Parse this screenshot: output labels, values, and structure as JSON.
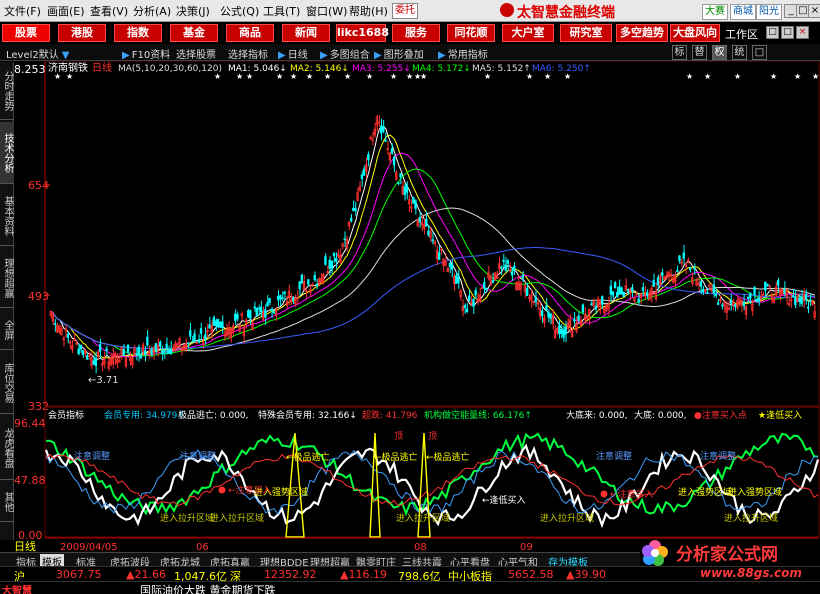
{
  "menubar": {
    "items": [
      "文件(F)",
      "画面(E)",
      "查看(V)",
      "分析(A)",
      "决策(J)",
      "公式(Q)",
      "工具(T)",
      "窗口(W)",
      "帮助(H)"
    ],
    "special_button": "委托",
    "brand": "太智慧金融终端",
    "skins": [
      "大赛",
      "商城",
      "阳光"
    ],
    "window_controls": [
      "_",
      "□",
      "×"
    ]
  },
  "toolbar": {
    "buttons": [
      "股票",
      "港股",
      "指数",
      "基金",
      "商品",
      "新闻",
      "likc1688",
      "服务",
      "同花顺",
      "大户室",
      "研究室",
      "多空趋势",
      "大盘风向"
    ],
    "workarea": "工作区",
    "controls": [
      "□",
      "□",
      "×"
    ]
  },
  "subbar": {
    "items": [
      "Level2默认",
      "F10资料",
      "选择股票",
      "选择指标",
      "日线",
      "多图组合",
      "图形叠加",
      "常用指标"
    ],
    "tabs": [
      "标",
      "替",
      "权",
      "统",
      "□"
    ]
  },
  "left_tabs": [
    "分时走势",
    "技术分析",
    "基本资料",
    "理想超赢",
    "全屏",
    "库位交易",
    "龙虎看盘",
    "其他"
  ],
  "price_chart": {
    "stock_name": "济南钢铁",
    "period": "日线",
    "ma_params": "MA(5,10,20,30,60,120)",
    "ma_values": [
      {
        "label": "MA1: 5.046↓",
        "color": "#ffffff"
      },
      {
        "label": "MA2: 5.146↓",
        "color": "#ffff00"
      },
      {
        "label": "MA3: 5.255↓",
        "color": "#ff00ff"
      },
      {
        "label": "MA4: 5.172↓",
        "color": "#00ff00"
      },
      {
        "label": "MA5: 5.152↑",
        "color": "#dddddd"
      },
      {
        "label": "MA6: 5.250↑",
        "color": "#3a5bff"
      }
    ],
    "y_ticks": [
      "8.253",
      "654",
      "493",
      "332"
    ],
    "low_marker": "←3.71"
  },
  "indicator": {
    "labels": [
      {
        "text": "会员指标",
        "color": "#ffffff"
      },
      {
        "text": "会员专用: 34.979↑",
        "color": "#00c8ff"
      },
      {
        "text": "极品逃亡: 0.000,",
        "color": "#ffffff"
      },
      {
        "text": "特殊会员专用: 32.166↓",
        "color": "#ffffff"
      },
      {
        "text": "超跌: 41.796",
        "color": "#ff3030"
      },
      {
        "text": "机构做空能量线: 66.176↑",
        "color": "#00ff40"
      },
      {
        "text": "大底来: 0.000,",
        "color": "#ffffff"
      },
      {
        "text": "大底: 0.000,",
        "color": "#ffffff"
      },
      {
        "text": "●注意买入点",
        "color": "#ff3030"
      },
      {
        "text": "★逢低买入",
        "color": "#ffff00"
      }
    ],
    "y_ticks": [
      "96.44",
      "47.88",
      "0.00"
    ],
    "annotations": {
      "watch": "注意调整",
      "escape": "←极品逃亡",
      "strong": "进入强势区域",
      "pull": "进入拉升区域",
      "buy_dip": "←逢低买入",
      "attention_buy": "←注意买入",
      "top": "顶"
    }
  },
  "time_axis": {
    "period_label": "日线",
    "labels": [
      "2009/04/05",
      "06",
      "08",
      "09"
    ]
  },
  "bottom_tabs": [
    "指标",
    "模板",
    "标准",
    "虎拓波段",
    "虎拓龙城",
    "虎拓真赢",
    "理想BDDE",
    "理想超赢",
    "飘零盯庄",
    "三线共震",
    "心平看盘",
    "心平气和",
    "存为模板"
  ],
  "quotes": {
    "sh_label": "沪",
    "sh_value": "3067.75",
    "sh_change": "21.66",
    "sh_amount": "1,047.6亿",
    "sz_label": "深",
    "sz_value": "12352.92",
    "sz_change": "116.19",
    "sz_amount": "798.6亿",
    "sme_label": "中小板指",
    "sme_value": "5652.58",
    "sme_change": "39.90"
  },
  "news": {
    "app_label": "大智慧",
    "text": "国际油价大跌 黄金期货下跌"
  },
  "watermark": {
    "title": "分析家公式网",
    "url": "www.88gs.com"
  },
  "colors": {
    "up": "#ff3030",
    "down": "#00ffff",
    "accent": "#c80000"
  }
}
